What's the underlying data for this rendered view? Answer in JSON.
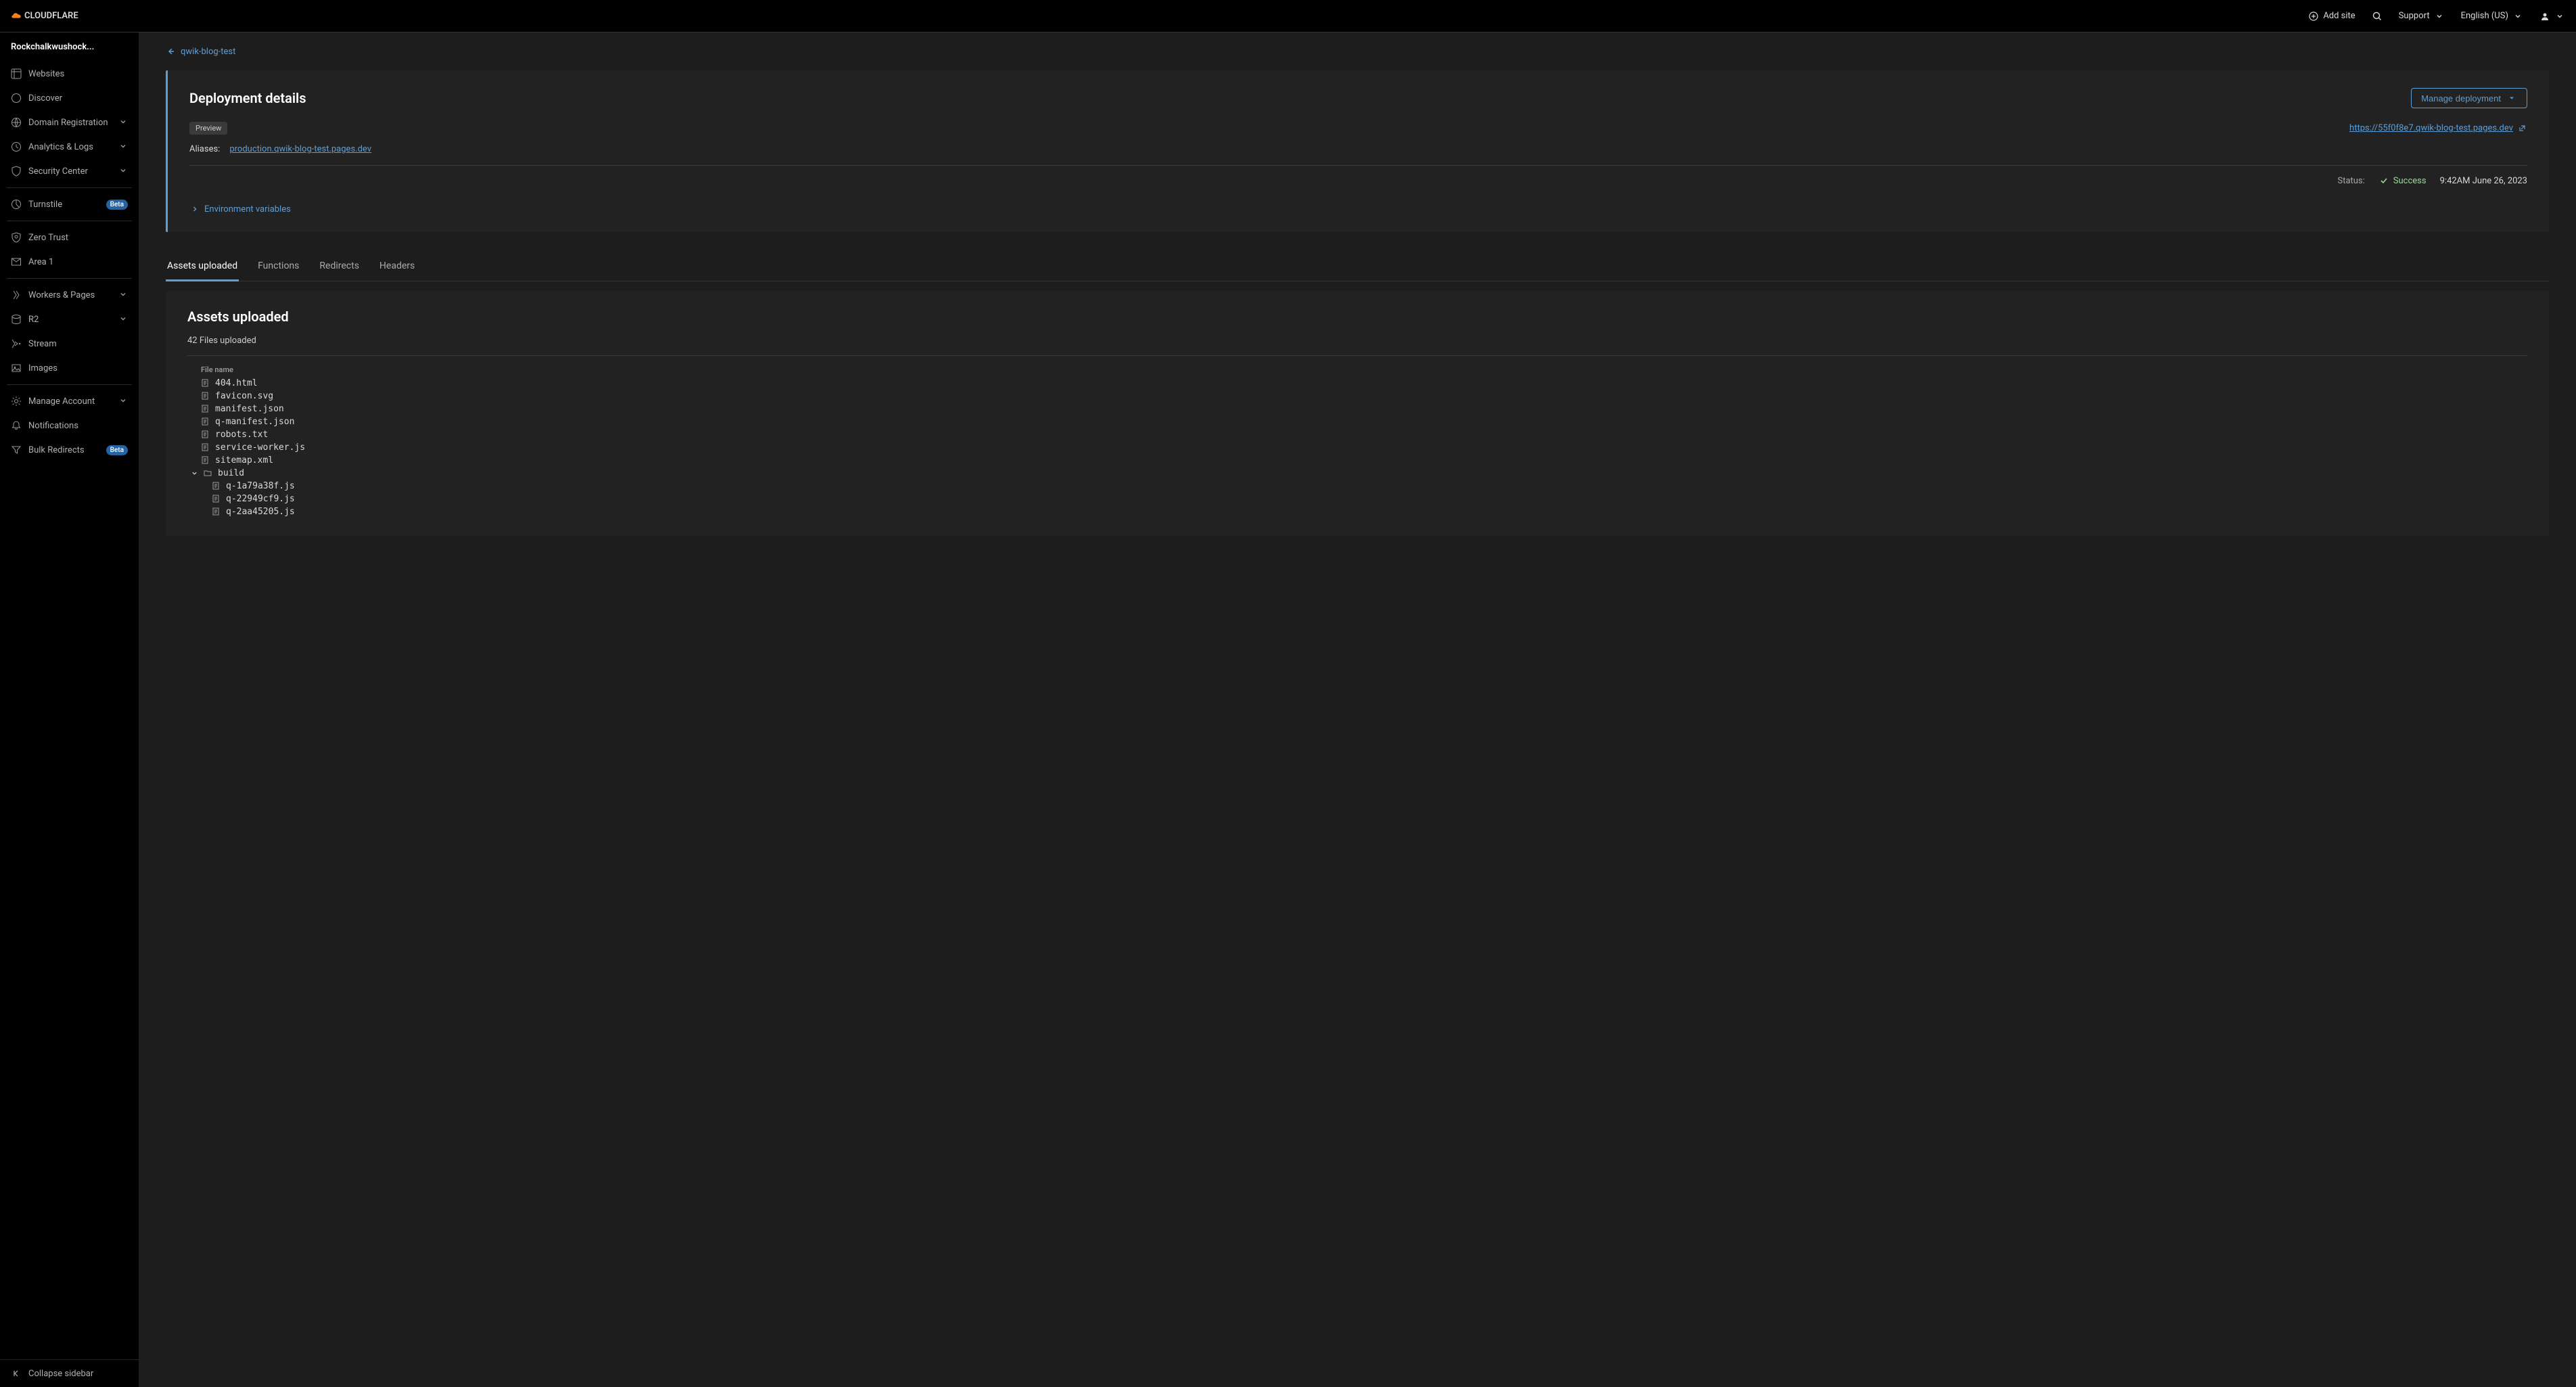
{
  "topbar": {
    "logo_text": "CLOUDFLARE",
    "add_site": "Add site",
    "support": "Support",
    "language": "English (US)"
  },
  "sidebar": {
    "account": "Rockchalkwushock...",
    "items": [
      {
        "label": "Websites",
        "icon": "globe-grid-icon",
        "expandable": false
      },
      {
        "label": "Discover",
        "icon": "compass-icon",
        "expandable": false
      },
      {
        "label": "Domain Registration",
        "icon": "globe-icon",
        "expandable": true
      },
      {
        "label": "Analytics & Logs",
        "icon": "clock-icon",
        "expandable": true
      },
      {
        "label": "Security Center",
        "icon": "shield-icon",
        "expandable": true
      }
    ],
    "items2": [
      {
        "label": "Turnstile",
        "icon": "turnstile-icon",
        "beta": true
      }
    ],
    "items3": [
      {
        "label": "Zero Trust",
        "icon": "zero-trust-icon"
      },
      {
        "label": "Area 1",
        "icon": "envelope-icon"
      }
    ],
    "items4": [
      {
        "label": "Workers & Pages",
        "icon": "workers-icon",
        "expandable": true
      },
      {
        "label": "R2",
        "icon": "storage-icon",
        "expandable": true
      },
      {
        "label": "Stream",
        "icon": "stream-icon"
      },
      {
        "label": "Images",
        "icon": "images-icon"
      }
    ],
    "items5": [
      {
        "label": "Manage Account",
        "icon": "gear-icon",
        "expandable": true
      },
      {
        "label": "Notifications",
        "icon": "bell-icon"
      },
      {
        "label": "Bulk Redirects",
        "icon": "filter-icon",
        "beta": true
      }
    ],
    "beta_label": "Beta",
    "collapse": "Collapse sidebar"
  },
  "breadcrumb": {
    "back_label": "qwik-blog-test"
  },
  "deployment": {
    "title": "Deployment details",
    "manage_button": "Manage deployment",
    "preview_badge": "Preview",
    "preview_url": "https://55f0f8e7.qwik-blog-test.pages.dev",
    "aliases_label": "Aliases:",
    "alias_url": "production.qwik-blog-test.pages.dev",
    "status_label": "Status:",
    "status_value": "Success",
    "timestamp": "9:42AM June 26, 2023",
    "env_vars": "Environment variables"
  },
  "tabs": {
    "assets": "Assets uploaded",
    "functions": "Functions",
    "redirects": "Redirects",
    "headers": "Headers"
  },
  "assets": {
    "title": "Assets uploaded",
    "count": "42 Files uploaded",
    "column_header": "File name",
    "files": [
      "404.html",
      "favicon.svg",
      "manifest.json",
      "q-manifest.json",
      "robots.txt",
      "service-worker.js",
      "sitemap.xml"
    ],
    "folder": "build",
    "folder_files": [
      "q-1a79a38f.js",
      "q-22949cf9.js",
      "q-2aa45205.js"
    ]
  }
}
